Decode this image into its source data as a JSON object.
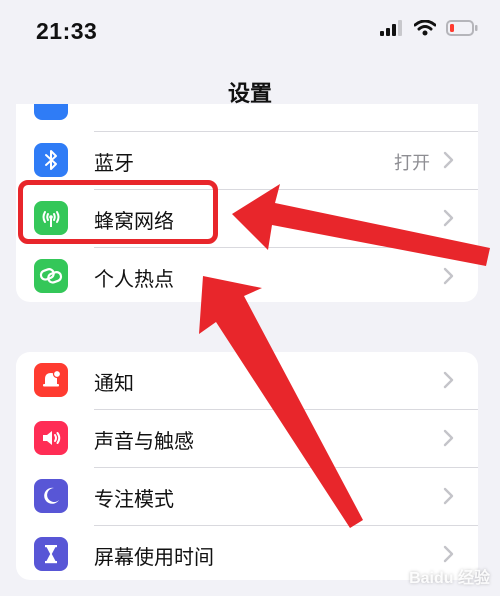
{
  "status_bar": {
    "time": "21:33",
    "icons": [
      "signal-icon",
      "wifi-icon",
      "battery-low-icon"
    ]
  },
  "header": {
    "title": "设置"
  },
  "groups": [
    {
      "items": [
        {
          "label": "蓝牙",
          "value": "打开",
          "icon": "bluetooth-icon",
          "color": "#2f7cf6"
        },
        {
          "label": "蜂窝网络",
          "value": "",
          "icon": "cellular-antenna-icon",
          "color": "#34c759"
        },
        {
          "label": "个人热点",
          "value": "",
          "icon": "hotspot-link-icon",
          "color": "#34c759"
        }
      ]
    },
    {
      "items": [
        {
          "label": "通知",
          "value": "",
          "icon": "notification-bell-icon",
          "color": "#ff3b30"
        },
        {
          "label": "声音与触感",
          "value": "",
          "icon": "speaker-icon",
          "color": "#ff2d55"
        },
        {
          "label": "专注模式",
          "value": "",
          "icon": "moon-icon",
          "color": "#5856d6"
        },
        {
          "label": "屏幕使用时间",
          "value": "",
          "icon": "hourglass-icon",
          "color": "#5856d6"
        }
      ]
    }
  ],
  "annotation": {
    "color": "#e8262b"
  }
}
